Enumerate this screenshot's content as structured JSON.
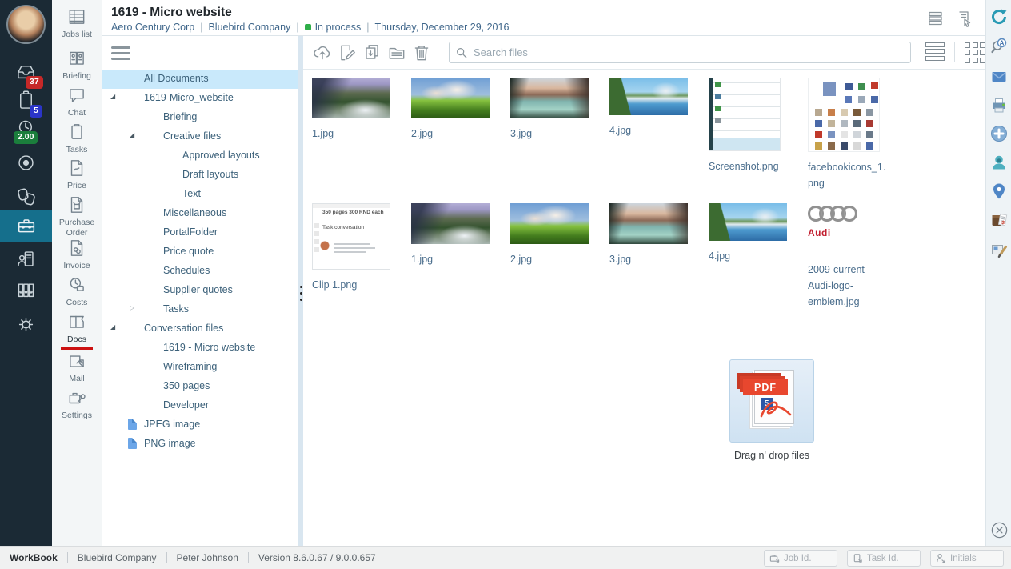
{
  "colors": {
    "sidebar_bg": "#1b2a35",
    "accent_teal": "#156f8c",
    "badge_red": "#c62828",
    "badge_blue": "#2b35c8",
    "badge_green": "#1b7e3c",
    "active_underline": "#cc1111",
    "selected_row_bg": "#c9e9fb",
    "status_green": "#2fae49"
  },
  "left_rail": {
    "badges": {
      "inbox": "37",
      "tasks": "5",
      "time": "2.00"
    }
  },
  "nav": {
    "items": [
      {
        "label": "Jobs list",
        "icon": "jobs-list-icon"
      },
      {
        "label": "Briefing",
        "icon": "briefing-icon"
      },
      {
        "label": "Chat",
        "icon": "chat-icon"
      },
      {
        "label": "Tasks",
        "icon": "tasks-icon"
      },
      {
        "label": "Price",
        "icon": "price-icon"
      },
      {
        "label": "Purchase Order",
        "icon": "purchase-order-icon"
      },
      {
        "label": "Invoice",
        "icon": "invoice-icon"
      },
      {
        "label": "Costs",
        "icon": "costs-icon"
      },
      {
        "label": "Docs",
        "icon": "docs-icon",
        "active": true
      },
      {
        "label": "Mail",
        "icon": "mail-icon"
      },
      {
        "label": "Settings",
        "icon": "settings-icon"
      }
    ]
  },
  "header": {
    "title": "1619 - Micro website",
    "client": "Aero Century Corp",
    "company": "Bluebird Company",
    "status": "In process",
    "date": "Thursday, December 29, 2016"
  },
  "tree": {
    "items": [
      {
        "label": "All Documents",
        "level": 0,
        "selected": true
      },
      {
        "label": "1619-Micro_website",
        "level": 0,
        "expander": "expanded"
      },
      {
        "label": "Briefing",
        "level": 1
      },
      {
        "label": "Creative files",
        "level": 1,
        "expander": "expanded"
      },
      {
        "label": "Approved layouts",
        "level": 2
      },
      {
        "label": "Draft layouts",
        "level": 2
      },
      {
        "label": "Text",
        "level": 2
      },
      {
        "label": "Miscellaneous",
        "level": 1
      },
      {
        "label": "PortalFolder",
        "level": 1
      },
      {
        "label": "Price quote",
        "level": 1
      },
      {
        "label": "Schedules",
        "level": 1
      },
      {
        "label": "Supplier quotes",
        "level": 1
      },
      {
        "label": "Tasks",
        "level": 1,
        "expander": "collapsed"
      },
      {
        "label": "Conversation files",
        "level": 0,
        "expander": "expanded"
      },
      {
        "label": "1619 - Micro website",
        "level": 1
      },
      {
        "label": "Wireframing",
        "level": 1
      },
      {
        "label": "350 pages",
        "level": 1
      },
      {
        "label": "Developer",
        "level": 1
      },
      {
        "label": "JPEG image",
        "level": 0,
        "icon": "file"
      },
      {
        "label": "PNG image",
        "level": 0,
        "icon": "file"
      }
    ]
  },
  "toolbar": {
    "search_placeholder": "Search files"
  },
  "files": {
    "items": [
      {
        "name": "1.jpg",
        "thumb": "land1",
        "row": 1
      },
      {
        "name": "2.jpg",
        "thumb": "land2",
        "row": 1
      },
      {
        "name": "3.jpg",
        "thumb": "land3",
        "row": 1
      },
      {
        "name": "4.jpg",
        "thumb": "land4",
        "row": 1
      },
      {
        "name": "Screenshot.png",
        "thumb": "shot",
        "row": 1
      },
      {
        "name": "facebookicons_1.png",
        "thumb": "fb",
        "row": 1
      },
      {
        "name": "Clip 1.png",
        "thumb": "clip",
        "row": 2
      },
      {
        "name": "1.jpg",
        "thumb": "land1",
        "row": 2
      },
      {
        "name": "2.jpg",
        "thumb": "land2",
        "row": 2
      },
      {
        "name": "3.jpg",
        "thumb": "land3",
        "row": 2
      },
      {
        "name": "4.jpg",
        "thumb": "land4",
        "row": 2
      },
      {
        "name": "2009-current-Audi-logo-emblem.jpg",
        "thumb": "audi",
        "row": 2
      }
    ]
  },
  "clip_thumb": {
    "title": "350 pages 300 RND each",
    "subtitle": "Task conversation"
  },
  "audi_thumb": {
    "brand": "Audi"
  },
  "pdf_thumb": {
    "label": "PDF",
    "count": "5"
  },
  "dropzone": {
    "label": "Drag n' drop files"
  },
  "statusbar": {
    "app": "WorkBook",
    "company": "Bluebird Company",
    "user": "Peter Johnson",
    "version": "Version 8.6.0.67 / 9.0.0.657",
    "job_placeholder": "Job Id.",
    "task_placeholder": "Task Id.",
    "initials_placeholder": "Initials"
  }
}
